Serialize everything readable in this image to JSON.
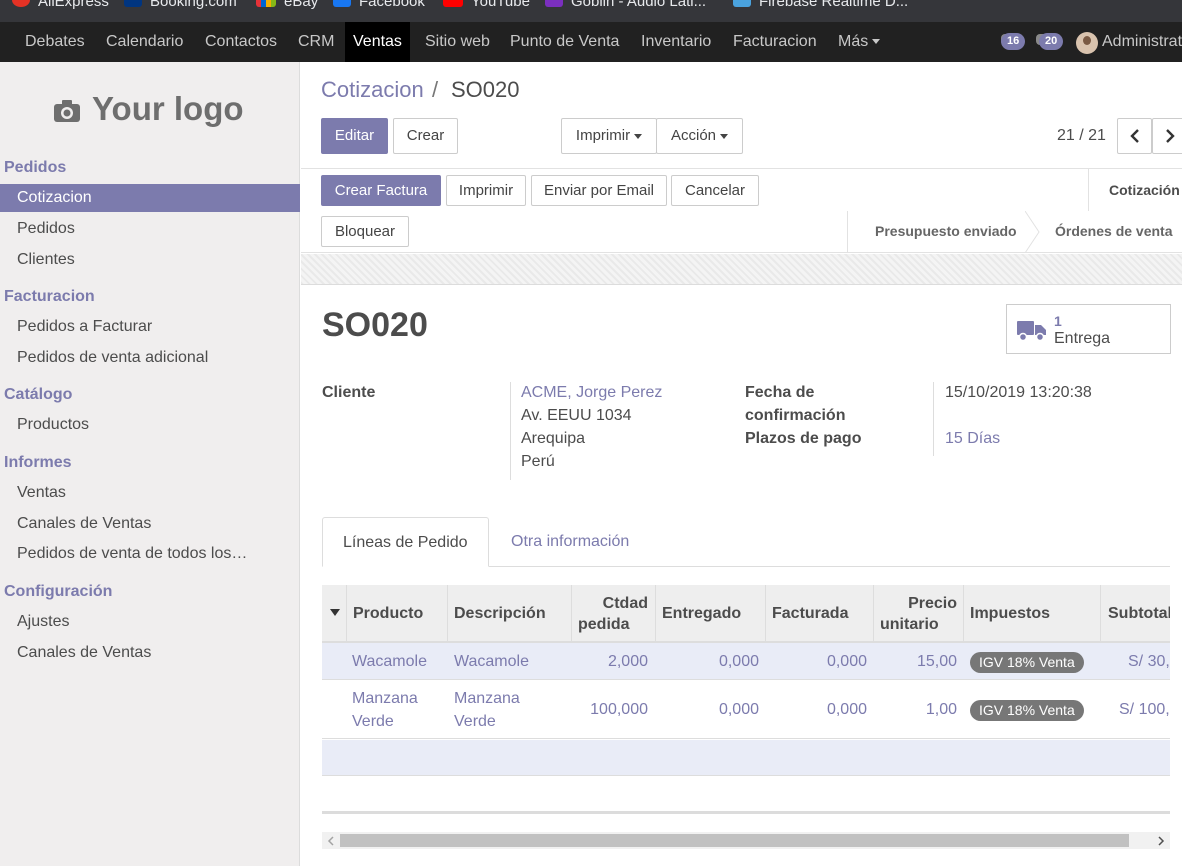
{
  "bookmarks": [
    {
      "label": "AliExpress",
      "color": "#e43225"
    },
    {
      "label": "Booking.com",
      "color": "#003580"
    },
    {
      "label": "eBay",
      "color": "#e53238"
    },
    {
      "label": "Facebook",
      "color": "#1877f2"
    },
    {
      "label": "YouTube",
      "color": "#ff0000"
    },
    {
      "label": "Goblin - Audio Lati...",
      "color": "#7b2fbf"
    },
    {
      "label": "Firebase Realtime D...",
      "color": "#4aa3df"
    }
  ],
  "topnav": {
    "items": [
      "Debates",
      "Calendario",
      "Contactos",
      "CRM",
      "Ventas",
      "Sitio web",
      "Punto de Venta",
      "Inventario",
      "Facturacion",
      "Más"
    ],
    "active": "Ventas",
    "activity_count": "16",
    "messages_count": "20",
    "user": "Administrat"
  },
  "sidebar": {
    "logo_text": "Your logo",
    "sections": [
      {
        "title": "Pedidos",
        "items": [
          "Cotizacion",
          "Pedidos",
          "Clientes"
        ]
      },
      {
        "title": "Facturacion",
        "items": [
          "Pedidos a Facturar",
          "Pedidos de venta adicional"
        ]
      },
      {
        "title": "Catálogo",
        "items": [
          "Productos"
        ]
      },
      {
        "title": "Informes",
        "items": [
          "Ventas",
          "Canales de Ventas",
          "Pedidos de venta de todos los…"
        ]
      },
      {
        "title": "Configuración",
        "items": [
          "Ajustes",
          "Canales de Ventas"
        ]
      }
    ],
    "active_item": "Cotizacion"
  },
  "breadcrumb": {
    "parent": "Cotizacion",
    "separator": "/",
    "current": "SO020"
  },
  "buttons": {
    "edit": "Editar",
    "create": "Crear",
    "print": "Imprimir",
    "action": "Acción",
    "pager": "21 / 21"
  },
  "statusbar": {
    "create_invoice": "Crear Factura",
    "print": "Imprimir",
    "send_email": "Enviar por Email",
    "cancel": "Cancelar",
    "lock": "Bloquear",
    "stages": [
      "Cotización",
      "Presupuesto enviado",
      "Órdenes de venta"
    ]
  },
  "record": {
    "name": "SO020",
    "delivery_count": "1",
    "delivery_label": "Entrega",
    "customer_label": "Cliente",
    "customer_name": "ACME, Jorge Perez",
    "customer_address": [
      "Av. EEUU 1034",
      "Arequipa",
      "Perú"
    ],
    "confirmation_label_1": "Fecha de",
    "confirmation_label_2": "confirmación",
    "confirmation_date": "15/10/2019 13:20:38",
    "payment_terms_label": "Plazos de pago",
    "payment_terms": "15 Días"
  },
  "tabs": [
    "Líneas de Pedido",
    "Otra información"
  ],
  "table": {
    "headers": {
      "product": "Producto",
      "description": "Descripción",
      "qty_1": "Ctdad",
      "qty_2": "pedida",
      "delivered": "Entregado",
      "invoiced": "Facturada",
      "price_1": "Precio",
      "price_2": "unitario",
      "taxes": "Impuestos",
      "subtotal": "Subtotal"
    },
    "rows": [
      {
        "product": "Wacamole",
        "description": "Wacamole",
        "qty": "2,000",
        "delivered": "0,000",
        "invoiced": "0,000",
        "price": "15,00",
        "tax": "IGV 18% Venta",
        "subtotal": "S/ 30,"
      },
      {
        "product_1": "Manzana",
        "product_2": "Verde",
        "description_1": "Manzana",
        "description_2": "Verde",
        "qty": "100,000",
        "delivered": "0,000",
        "invoiced": "0,000",
        "price": "1,00",
        "tax": "IGV 18% Venta",
        "subtotal": "S/ 100,"
      }
    ]
  },
  "colors": {
    "brand": "#7c7bad",
    "nav_bg": "#212121",
    "sidebar_bg": "#f0eeee"
  }
}
